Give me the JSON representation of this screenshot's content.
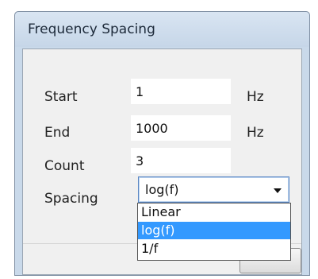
{
  "window": {
    "title": "Frequency Spacing"
  },
  "form": {
    "start": {
      "label": "Start",
      "value": "1",
      "unit": "Hz"
    },
    "end": {
      "label": "End",
      "value": "1000",
      "unit": "Hz"
    },
    "count": {
      "label": "Count",
      "value": "3"
    },
    "spacing": {
      "label": "Spacing",
      "selected": "log(f)",
      "options": [
        "Linear",
        "log(f)",
        "1/f"
      ]
    }
  },
  "colors": {
    "highlight": "#3399ff",
    "titlebar": "#c9d9ea"
  }
}
